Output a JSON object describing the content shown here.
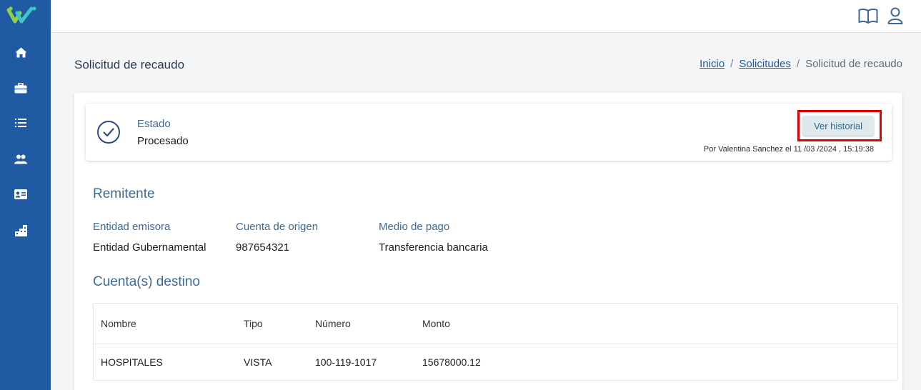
{
  "colors": {
    "sidebar": "#1f5aa2",
    "accent": "#3d6a96",
    "highlight": "#e00000",
    "button_bg": "#dfe9ec"
  },
  "sidebar": {
    "items": [
      {
        "icon": "home-icon"
      },
      {
        "icon": "briefcase-icon"
      },
      {
        "icon": "list-icon"
      },
      {
        "icon": "users-icon"
      },
      {
        "icon": "id-card-icon"
      },
      {
        "icon": "building-icon"
      }
    ]
  },
  "topbar": {
    "icons": [
      "book-icon",
      "user-icon"
    ]
  },
  "page": {
    "title": "Solicitud de recaudo"
  },
  "breadcrumb": {
    "items": [
      "Inicio",
      "Solicitudes",
      "Solicitud de recaudo"
    ],
    "separator": "/"
  },
  "status": {
    "label": "Estado",
    "value": "Procesado",
    "history_button": "Ver historial",
    "meta": "Por Valentina Sanchez el 11 /03 /2024 , 15:19:38"
  },
  "remitente": {
    "title": "Remitente",
    "fields": [
      {
        "label": "Entidad emisora",
        "value": "Entidad Gubernamental"
      },
      {
        "label": "Cuenta de origen",
        "value": "987654321"
      },
      {
        "label": "Medio de pago",
        "value": "Transferencia bancaria"
      }
    ]
  },
  "destino": {
    "title": "Cuenta(s) destino",
    "columns": [
      "Nombre",
      "Tipo",
      "Número",
      "Monto"
    ],
    "rows": [
      [
        "HOSPITALES",
        "VISTA",
        "100-119-1017",
        "15678000.12"
      ]
    ]
  }
}
